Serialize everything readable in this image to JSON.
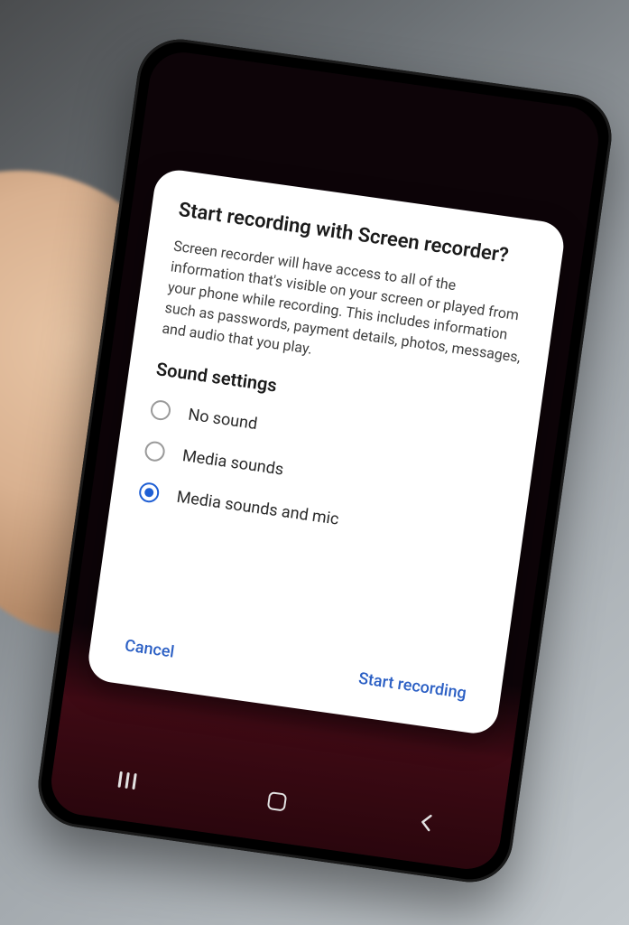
{
  "dialog": {
    "title": "Start recording with Screen recorder?",
    "body": "Screen recorder will have access to all of the information that's visible on your screen or played from your phone while recording. This includes information such as passwords, payment details, photos, messages, and audio that you play.",
    "sound_heading": "Sound settings",
    "options": [
      {
        "label": "No sound",
        "checked": false
      },
      {
        "label": "Media sounds",
        "checked": false
      },
      {
        "label": "Media sounds and mic",
        "checked": true
      }
    ],
    "cancel_label": "Cancel",
    "confirm_label": "Start recording"
  },
  "colors": {
    "accent": "#2b5fc4"
  }
}
